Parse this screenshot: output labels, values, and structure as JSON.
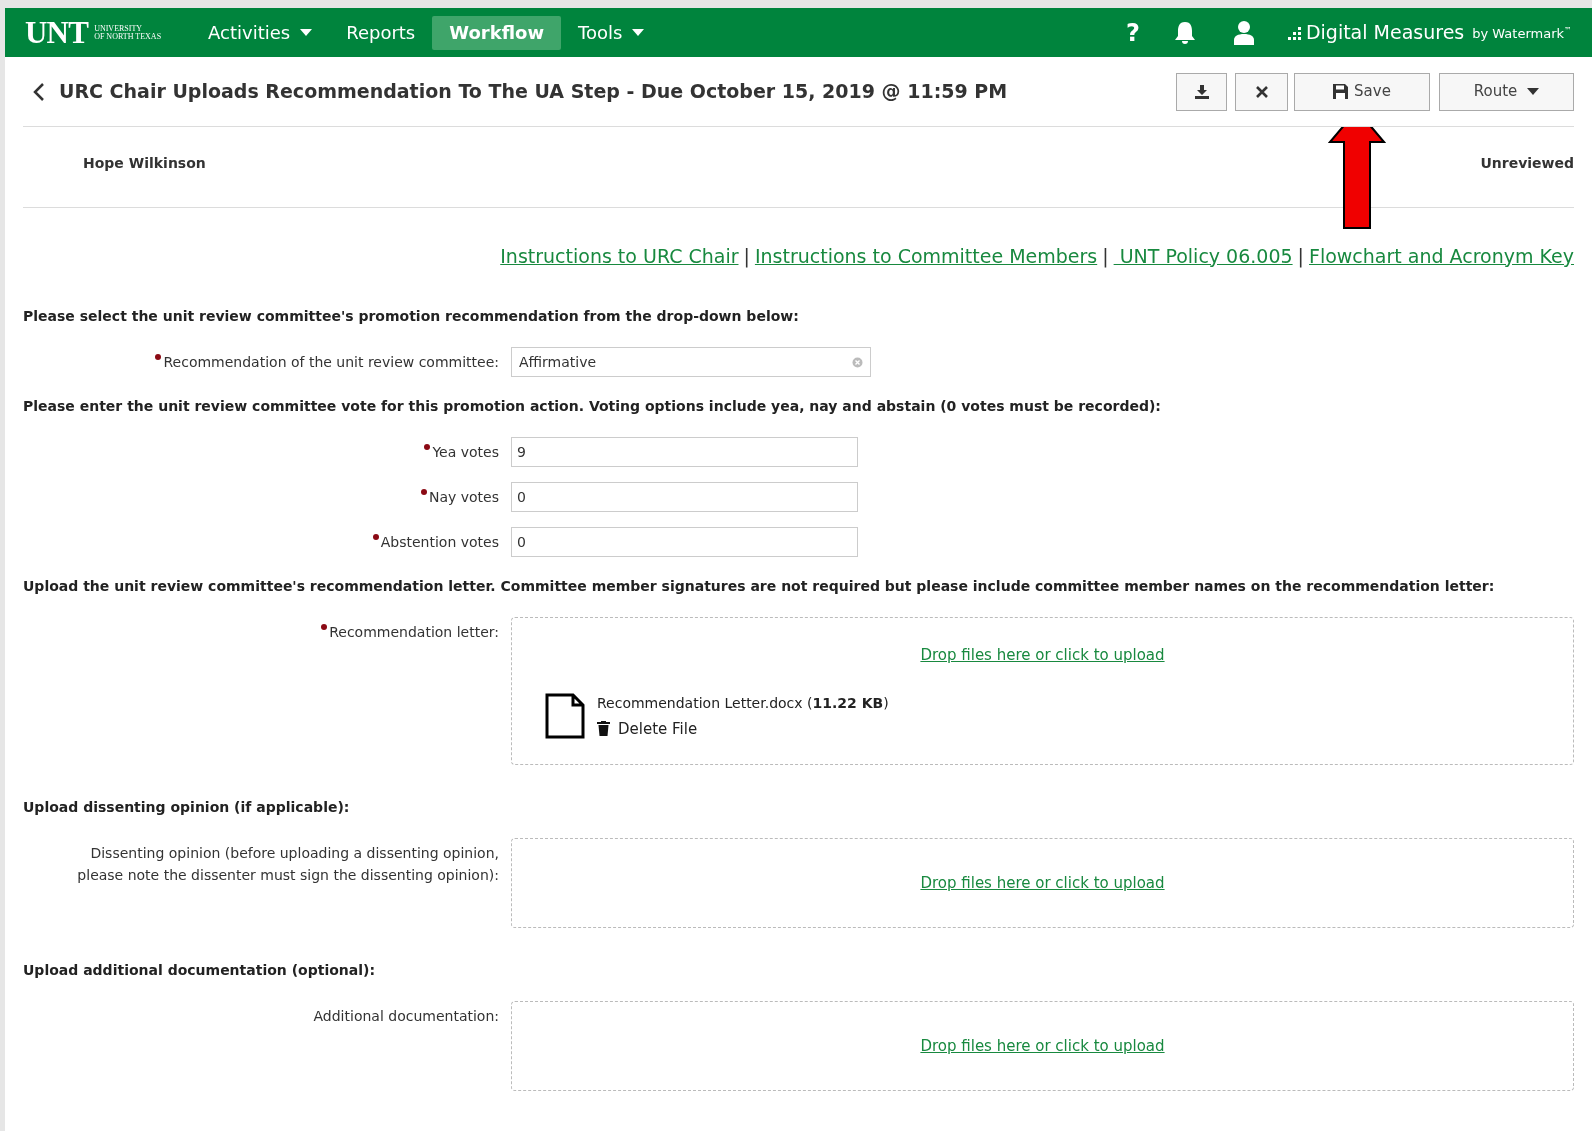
{
  "nav": {
    "logo": {
      "mark": "UNT",
      "line_1": "UNIVERSITY",
      "line_2": "OF NORTH TEXAS"
    },
    "items": [
      {
        "label": "Activities",
        "selected": false,
        "has_menu": true
      },
      {
        "label": "Reports",
        "selected": false,
        "has_menu": false
      },
      {
        "label": "Workflow",
        "selected": true,
        "has_menu": false
      },
      {
        "label": "Tools",
        "selected": false,
        "has_menu": true
      }
    ],
    "help": "?",
    "brand": "Digital Measures",
    "brand_by": "by Watermark",
    "trademark": "™"
  },
  "header": {
    "title": "URC Chair Uploads Recommendation To The UA Step - Due October 15, 2019 @ 11:59 PM",
    "buttons": [
      {
        "kind": "download"
      },
      {
        "kind": "close"
      },
      {
        "kind": "save",
        "label": "Save"
      },
      {
        "kind": "route",
        "label": "Route"
      }
    ]
  },
  "committee": {
    "members": [
      {
        "name": "Hope Wilkinson",
        "status": "Unreviewed"
      }
    ]
  },
  "links": {
    "separator": "|",
    "items": [
      "Instructions to URC Chair",
      "Instructions to Committee Members",
      " UNT Policy 06.005",
      "Flowchart and Acronym Key"
    ]
  },
  "sections": [
    {
      "heading": "Please select the unit review committee's promotion recommendation from the drop-down below:",
      "fields": [
        {
          "kind": "select",
          "label": "Recommendation of the unit review committee:",
          "required": true,
          "value": "Affirmative"
        }
      ]
    },
    {
      "heading": "Please enter the unit review committee vote for this promotion action.  Voting options include yea, nay and abstain (0 votes must be recorded):",
      "fields": [
        {
          "kind": "text",
          "label": "Yea votes",
          "required": true,
          "value": "9"
        },
        {
          "kind": "text",
          "label": "Nay votes",
          "required": true,
          "value": "0"
        },
        {
          "kind": "text",
          "label": "Abstention votes",
          "required": true,
          "value": "0"
        }
      ]
    },
    {
      "heading": "Upload the unit review committee's recommendation letter.  Committee member signatures are not required but please include committee member names on the recommendation letter:",
      "fields": [
        {
          "kind": "upload",
          "label": "Recommendation letter:",
          "required": true,
          "prompt": "Drop files here or click to upload",
          "files": [
            {
              "name": "Recommendation Letter.docx (**11.22 KB**)",
              "delete": "Delete File"
            }
          ]
        }
      ]
    },
    {
      "heading": "Upload dissenting opinion (if applicable):",
      "fields": [
        {
          "kind": "upload",
          "label": "Dissenting opinion (before uploading a dissenting opinion, please note the dissenter must sign the dissenting opinion):",
          "required": false,
          "prompt": "Drop files here or click to upload"
        }
      ]
    },
    {
      "heading": "Upload additional documentation (optional):",
      "fields": [
        {
          "kind": "upload",
          "label": "Additional documentation:",
          "required": false,
          "prompt": "Drop files here or click to upload"
        }
      ]
    }
  ]
}
